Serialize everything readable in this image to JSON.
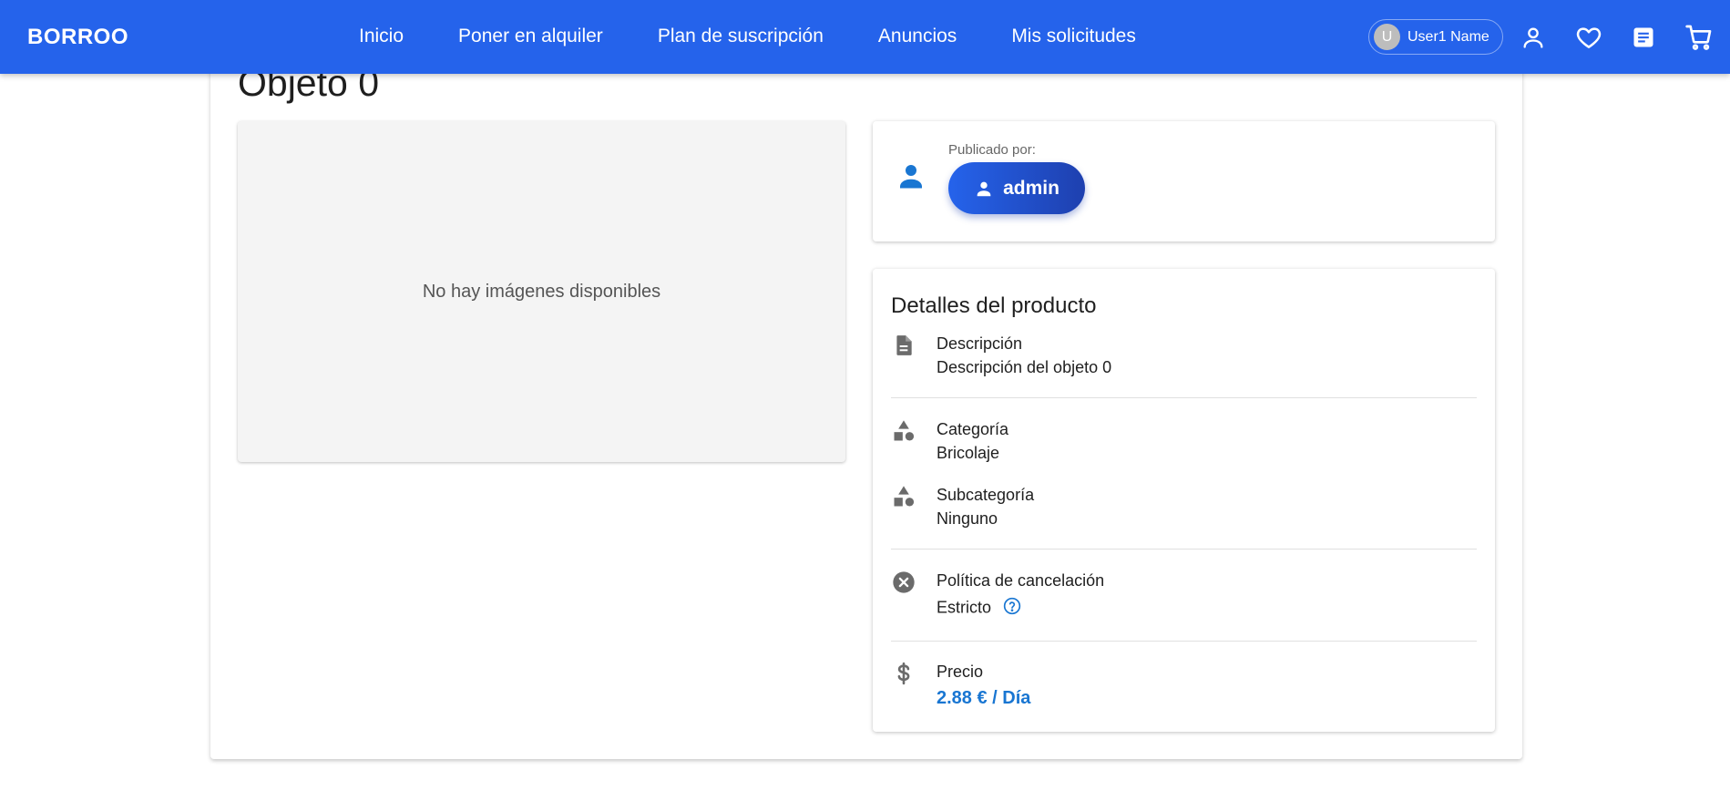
{
  "brand": "BORROO",
  "nav": {
    "links": [
      "Inicio",
      "Poner en alquiler",
      "Plan de suscripción",
      "Anuncios",
      "Mis solicitudes"
    ],
    "user": {
      "initial": "U",
      "name": "User1 Name"
    }
  },
  "page": {
    "title": "Objeto 0",
    "no_images": "No hay imágenes disponibles"
  },
  "publisher": {
    "label": "Publicado por:",
    "name": "admin"
  },
  "details": {
    "title": "Detalles del producto",
    "description": {
      "label": "Descripción",
      "value": "Descripción del objeto 0"
    },
    "category": {
      "label": "Categoría",
      "value": "Bricolaje"
    },
    "subcategory": {
      "label": "Subcategoría",
      "value": "Ninguno"
    },
    "cancellation": {
      "label": "Política de cancelación",
      "value": "Estricto"
    },
    "price": {
      "label": "Precio",
      "value": "2.88 € / Día"
    }
  },
  "colors": {
    "navbar": "#2563eb",
    "accent": "#1976d2",
    "icon_gray": "#6b6b6b"
  }
}
